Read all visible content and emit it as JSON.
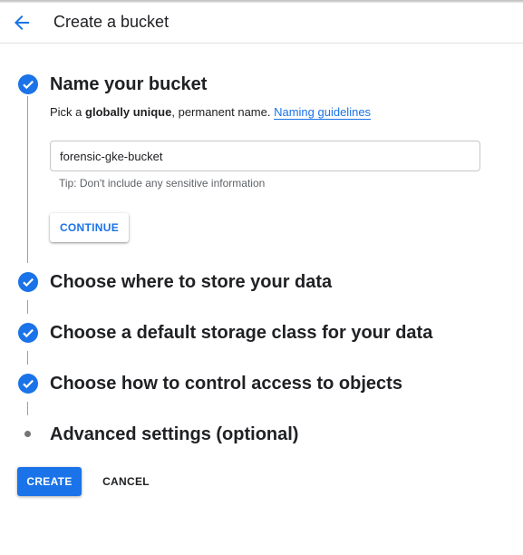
{
  "header": {
    "title": "Create a bucket",
    "back_icon": "arrow-back-icon"
  },
  "colors": {
    "accent": "#1a73e8",
    "text": "#202124",
    "muted": "#5f6368"
  },
  "steps": [
    {
      "title": "Name your bucket",
      "state": "completed",
      "icon": "check-circle-icon"
    },
    {
      "title": "Choose where to store your data",
      "state": "completed",
      "icon": "check-circle-icon"
    },
    {
      "title": "Choose a default storage class for your data",
      "state": "completed",
      "icon": "check-circle-icon"
    },
    {
      "title": "Choose how to control access to objects",
      "state": "completed",
      "icon": "check-circle-icon"
    },
    {
      "title": "Advanced settings (optional)",
      "state": "optional",
      "icon": "dot-icon"
    }
  ],
  "name_step": {
    "desc_prefix": "Pick a ",
    "desc_bold": "globally unique",
    "desc_suffix": ", permanent name. ",
    "link": "Naming guidelines",
    "input_value": "forensic-gke-bucket",
    "tip": "Tip: Don't include any sensitive information",
    "continue_label": "CONTINUE"
  },
  "actions": {
    "create_label": "CREATE",
    "cancel_label": "CANCEL"
  }
}
